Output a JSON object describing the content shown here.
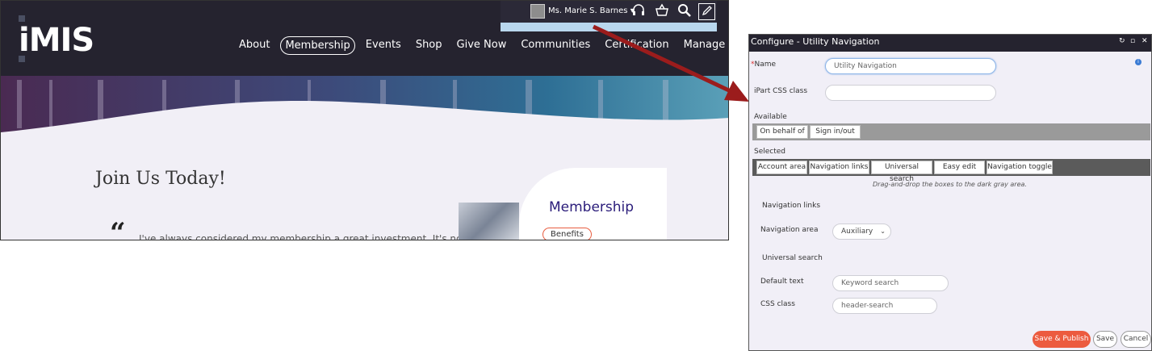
{
  "website": {
    "logo": "iMIS",
    "utility": {
      "user_name": "Ms. Marie S. Barnes",
      "icons": [
        "headset-icon",
        "basket-icon",
        "search-icon",
        "edit-icon"
      ]
    },
    "nav": {
      "items": [
        "About",
        "Membership",
        "Events",
        "Shop",
        "Give Now",
        "Communities",
        "Certification",
        "Manage"
      ],
      "active": "Membership"
    },
    "join_heading": "Join Us Today!",
    "quote_mark": "“",
    "quote_text": "I've always considered my membership a great investment. It's not",
    "card": {
      "title": "Membership",
      "button": "Benefits"
    }
  },
  "dialog": {
    "title": "Configure - Utility Navigation",
    "required_mark": "*",
    "name_label": "Name",
    "name_value": "Utility Navigation",
    "css_label": "iPart CSS class",
    "css_value": "",
    "available_label": "Available",
    "available_items": [
      "On behalf of",
      "Sign in/out"
    ],
    "selected_label": "Selected",
    "selected_items": [
      "Account area",
      "Navigation links",
      "Universal search",
      "Easy edit",
      "Navigation toggle"
    ],
    "hint": "Drag-and-drop the boxes to the dark gray area.",
    "nav_links_heading": "Navigation links",
    "nav_area_label": "Navigation area",
    "nav_area_value": "Auxiliary",
    "universal_search_heading": "Universal search",
    "default_text_label": "Default text",
    "default_text_value": "Keyword search",
    "search_css_label": "CSS class",
    "search_css_value": "header-search",
    "buttons": {
      "save_publish": "Save & Publish",
      "save": "Save",
      "cancel": "Cancel"
    }
  },
  "colors": {
    "header_bg": "#25232f",
    "accent": "#ec5b3f",
    "arrow": "#9b1c1c"
  }
}
